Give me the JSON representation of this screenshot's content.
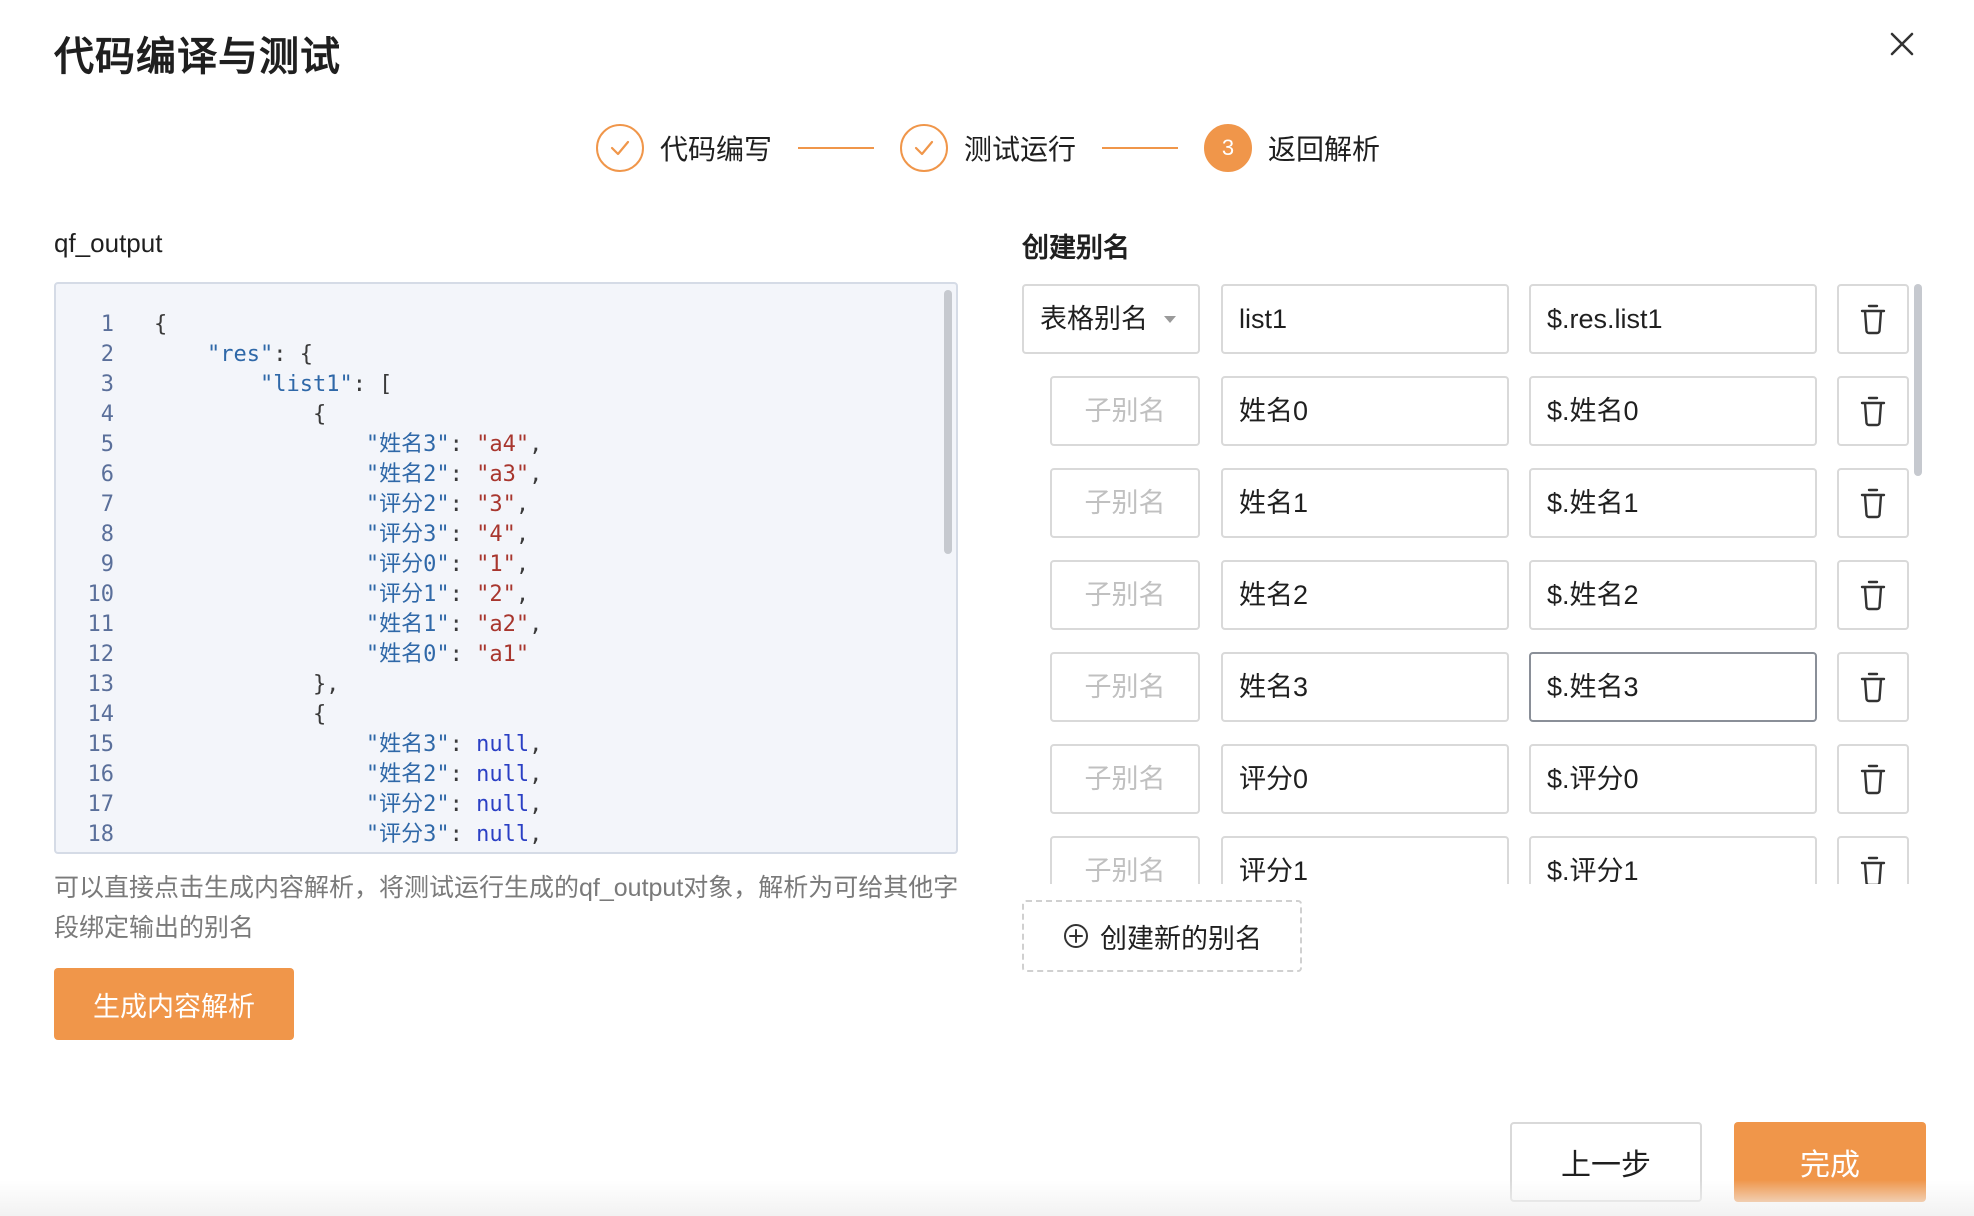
{
  "dialog": {
    "title": "代码编译与测试",
    "close_icon": "close-icon"
  },
  "steps": [
    {
      "label": "代码编写",
      "status": "done"
    },
    {
      "label": "测试运行",
      "status": "done"
    },
    {
      "label": "返回解析",
      "status": "active",
      "number": "3"
    }
  ],
  "colors": {
    "accent": "#f0964a",
    "border": "#d9d9d9",
    "placeholder": "#c0c0c0"
  },
  "left": {
    "label": "qf_output",
    "code_lines": [
      {
        "n": "1",
        "text": "{"
      },
      {
        "n": "2",
        "text": "    \"res\": {"
      },
      {
        "n": "3",
        "text": "        \"list1\": ["
      },
      {
        "n": "4",
        "text": "            {"
      },
      {
        "n": "5",
        "text": "                \"姓名3\": \"a4\","
      },
      {
        "n": "6",
        "text": "                \"姓名2\": \"a3\","
      },
      {
        "n": "7",
        "text": "                \"评分2\": \"3\","
      },
      {
        "n": "8",
        "text": "                \"评分3\": \"4\","
      },
      {
        "n": "9",
        "text": "                \"评分0\": \"1\","
      },
      {
        "n": "10",
        "text": "                \"评分1\": \"2\","
      },
      {
        "n": "11",
        "text": "                \"姓名1\": \"a2\","
      },
      {
        "n": "12",
        "text": "                \"姓名0\": \"a1\""
      },
      {
        "n": "13",
        "text": "            },"
      },
      {
        "n": "14",
        "text": "            {"
      },
      {
        "n": "15",
        "text": "                \"姓名3\": null,"
      },
      {
        "n": "16",
        "text": "                \"姓名2\": null,"
      },
      {
        "n": "17",
        "text": "                \"评分2\": null,"
      },
      {
        "n": "18",
        "text": "                \"评分3\": null,"
      }
    ],
    "hint": "可以直接点击生成内容解析，将测试运行生成的qf_output对象，解析为可给其他字段绑定输出的别名",
    "generate_button": "生成内容解析"
  },
  "right": {
    "label": "创建别名",
    "type_select": "表格别名",
    "sub_placeholder": "子别名",
    "rows": [
      {
        "type": "表格别名",
        "name": "list1",
        "path": "$.res.list1"
      },
      {
        "type": "子别名",
        "name": "姓名0",
        "path": "$.姓名0"
      },
      {
        "type": "子别名",
        "name": "姓名1",
        "path": "$.姓名1"
      },
      {
        "type": "子别名",
        "name": "姓名2",
        "path": "$.姓名2"
      },
      {
        "type": "子别名",
        "name": "姓名3",
        "path": "$.姓名3"
      },
      {
        "type": "子别名",
        "name": "评分0",
        "path": "$.评分0"
      },
      {
        "type": "子别名",
        "name": "评分1",
        "path": "$.评分1"
      }
    ],
    "add_button": "创建新的别名",
    "delete_icon": "trash-icon",
    "add_icon": "plus-circle-icon"
  },
  "footer": {
    "prev_button": "上一步",
    "done_button": "完成"
  }
}
